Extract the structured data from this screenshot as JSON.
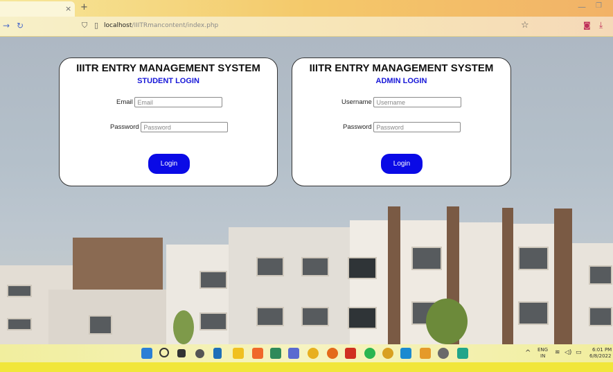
{
  "browser": {
    "tab_close": "×",
    "new_tab": "+",
    "url_host": "localhost",
    "url_path": "/IIITRmancontent/index.php"
  },
  "student_card": {
    "title": "IIITR ENTRY MANAGEMENT SYSTEM",
    "subtitle": "STUDENT LOGIN",
    "email_label": "Email",
    "email_placeholder": "Email",
    "password_label": "Password",
    "password_placeholder": "Password",
    "button": "Login"
  },
  "admin_card": {
    "title": "IIITR ENTRY MANAGEMENT SYSTEM",
    "subtitle": "ADMIN LOGIN",
    "username_label": "Username",
    "username_placeholder": "Username",
    "password_label": "Password",
    "password_placeholder": "Password",
    "button": "Login"
  },
  "taskbar": {
    "lang_1": "ENG",
    "lang_2": "IN",
    "time": "6:01 PM",
    "date": "6/8/2022"
  },
  "colors": {
    "accent": "#0a0ae6",
    "subtitle": "#1616d8"
  }
}
